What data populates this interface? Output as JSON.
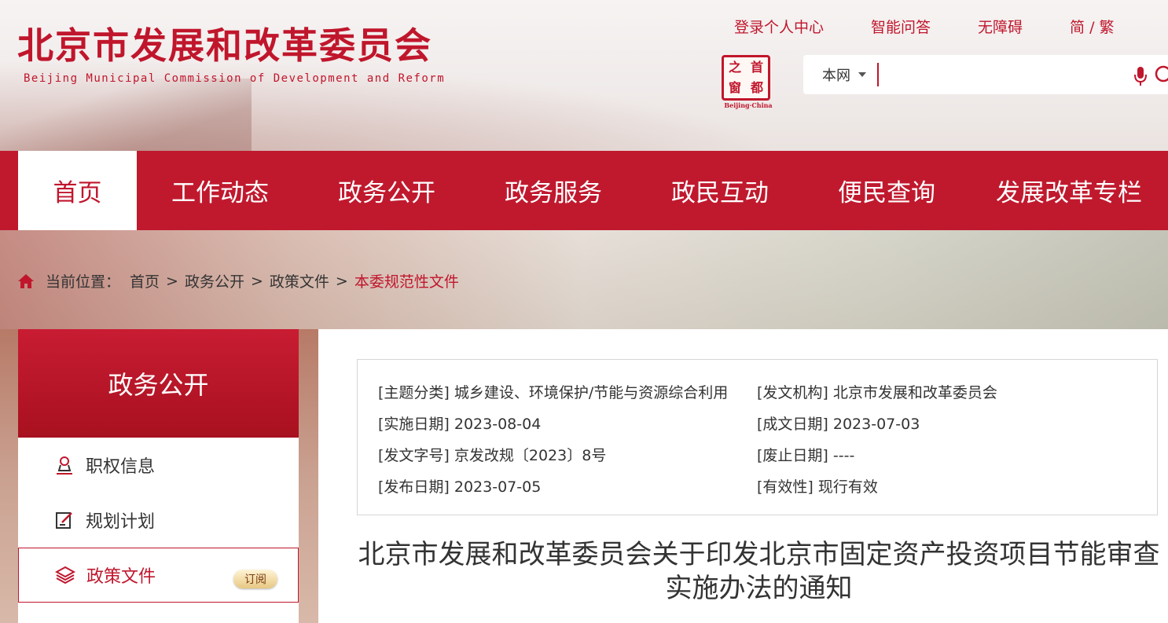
{
  "header": {
    "title": "北京市发展和改革委员会",
    "subtitle": "Beijing Municipal Commission of Development and Reform",
    "top_links": [
      "登录个人中心",
      "智能问答",
      "无障碍",
      "简 / 繁"
    ],
    "seal": {
      "chars": [
        "之",
        "首",
        "窗",
        "都"
      ],
      "caption": "Beijing·China"
    },
    "search": {
      "scope": "本网",
      "placeholder": ""
    }
  },
  "nav": {
    "items": [
      "首页",
      "工作动态",
      "政务公开",
      "政务服务",
      "政民互动",
      "便民查询",
      "发展改革专栏"
    ],
    "active_index": 0
  },
  "breadcrumb": {
    "label": "当前位置：",
    "items": [
      "首页",
      "政务公开",
      "政策文件",
      "本委规范性文件"
    ],
    "separator": ">"
  },
  "sidebar": {
    "heading": "政务公开",
    "items": [
      {
        "label": "职权信息",
        "icon": "person-stamp-icon"
      },
      {
        "label": "规划计划",
        "icon": "edit-doc-icon"
      },
      {
        "label": "政策文件",
        "icon": "layers-icon",
        "badge": "订阅",
        "active": true
      }
    ]
  },
  "meta": {
    "topic_label": "[主题分类]",
    "topic": "城乡建设、环境保护/节能与资源综合利用",
    "issuer_label": "[发文机构]",
    "issuer": "北京市发展和改革委员会",
    "effective_label": "[实施日期]",
    "effective": "2023-08-04",
    "written_label": "[成文日期]",
    "written": "2023-07-03",
    "docno_label": "[发文字号]",
    "docno": "京发改规〔2023〕8号",
    "expire_label": "[废止日期]",
    "expire": "----",
    "published_label": "[发布日期]",
    "published": "2023-07-05",
    "validity_label": "[有效性]",
    "validity": "现行有效"
  },
  "document": {
    "title": "北京市发展和改革委员会关于印发北京市固定资产投资项目节能审查实施办法的通知"
  },
  "colors": {
    "brand_red": "#c0162c",
    "nav_red": "#c0192e",
    "white": "#ffffff"
  }
}
